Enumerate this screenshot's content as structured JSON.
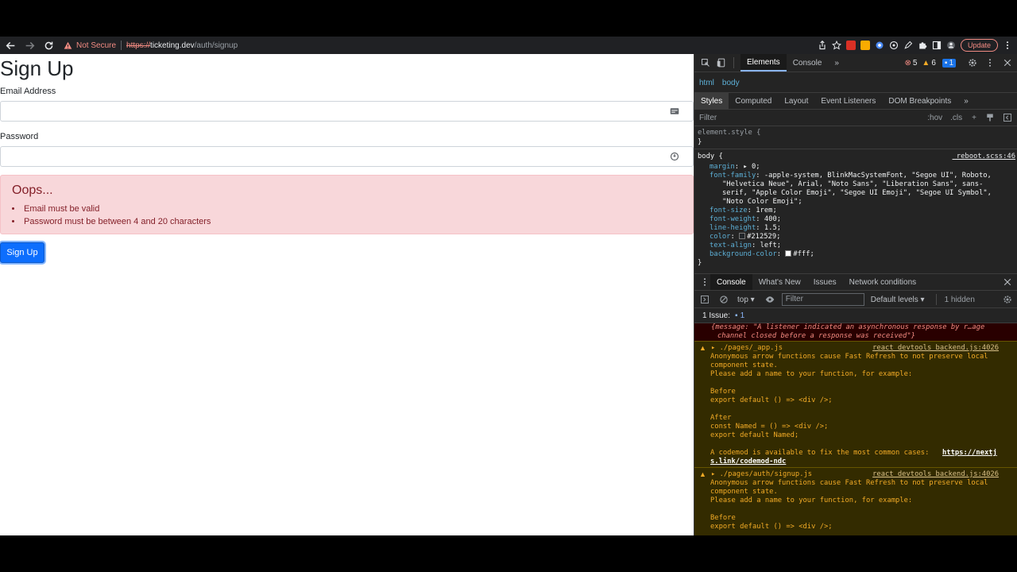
{
  "browser": {
    "security_label": "Not Secure",
    "url_scheme": "https://",
    "url_host": "ticketing.dev",
    "url_path": "/auth/signup",
    "update_label": "Update"
  },
  "page": {
    "title": "Sign Up",
    "email_label": "Email Address",
    "email_value": "",
    "password_label": "Password",
    "password_value": "",
    "alert_title": "Oops...",
    "errors": [
      "Email must be valid",
      "Password must be between 4 and 20 characters"
    ],
    "submit_label": "Sign Up"
  },
  "devtools": {
    "tabs": [
      "Elements",
      "Console"
    ],
    "errors_count": "5",
    "warnings_count": "6",
    "messages_count": "1",
    "breadcrumb": [
      "html",
      "body"
    ],
    "styles_tabs": [
      "Styles",
      "Computed",
      "Layout",
      "Event Listeners",
      "DOM Breakpoints"
    ],
    "filter_placeholder": "Filter",
    "hov": ":hov",
    "cls": ".cls",
    "element_style": "element.style {",
    "close_brace": "}",
    "body_selector": "body {",
    "body_source": "_reboot.scss:46",
    "rules": {
      "margin_prop": "margin",
      "margin_val": "0;",
      "font_family_prop": "font-family",
      "font_family_val_1": "-apple-system, BlinkMacSystemFont, \"Segoe UI\", Roboto,",
      "font_family_val_2": "\"Helvetica Neue\", Arial, \"Noto Sans\", \"Liberation Sans\", sans-",
      "font_family_val_3": "serif, \"Apple Color Emoji\", \"Segoe UI Emoji\", \"Segoe UI Symbol\",",
      "font_family_val_4": "\"Noto Color Emoji\";",
      "font_size_prop": "font-size",
      "font_size_val": "1rem;",
      "font_weight_prop": "font-weight",
      "font_weight_val": "400;",
      "line_height_prop": "line-height",
      "line_height_val": "1.5;",
      "color_prop": "color",
      "color_val": "#212529;",
      "text_align_prop": "text-align",
      "text_align_val": "left;",
      "bg_prop": "background-color",
      "bg_val": "#fff;"
    },
    "drawer_tabs": [
      "Console",
      "What's New",
      "Issues",
      "Network conditions"
    ],
    "context": "top",
    "console_filter_placeholder": "Filter",
    "levels": "Default levels",
    "hidden": "1 hidden",
    "issues_label": "1 Issue:",
    "issues_count": "1",
    "msg0_line1": "{message: \"A listener indicated an asynchronous response by r…age",
    "msg0_line2": "channel closed before a response was received\"}",
    "msg1": {
      "src": "react_devtools_backend.js:4026",
      "head": "▸ ./pages/_app.js",
      "l1": "Anonymous arrow functions cause Fast Refresh to not preserve local",
      "l2": "component state.",
      "l3": "Please add a name to your function, for example:",
      "l4": "Before",
      "l5": "export default () => <div />;",
      "l6": "After",
      "l7": "const Named = () => <div />;",
      "l8": "export default Named;",
      "l9": "A codemod is available to fix the most common cases:",
      "link1": "https://nextj",
      "link2": "s.link/codemod-ndc"
    },
    "msg2": {
      "src": "react_devtools_backend.js:4026",
      "head": "▸ ./pages/auth/signup.js",
      "l1": "Anonymous arrow functions cause Fast Refresh to not preserve local",
      "l2": "component state.",
      "l3": "Please add a name to your function, for example:",
      "l4": "Before",
      "l5": "export default () => <div />;"
    }
  },
  "colors": {
    "primary": "#0d6efd",
    "alert_bg": "#f8d7da",
    "alert_text": "#842029",
    "devtools_bg": "#242424",
    "warning_bg": "#332b00"
  }
}
